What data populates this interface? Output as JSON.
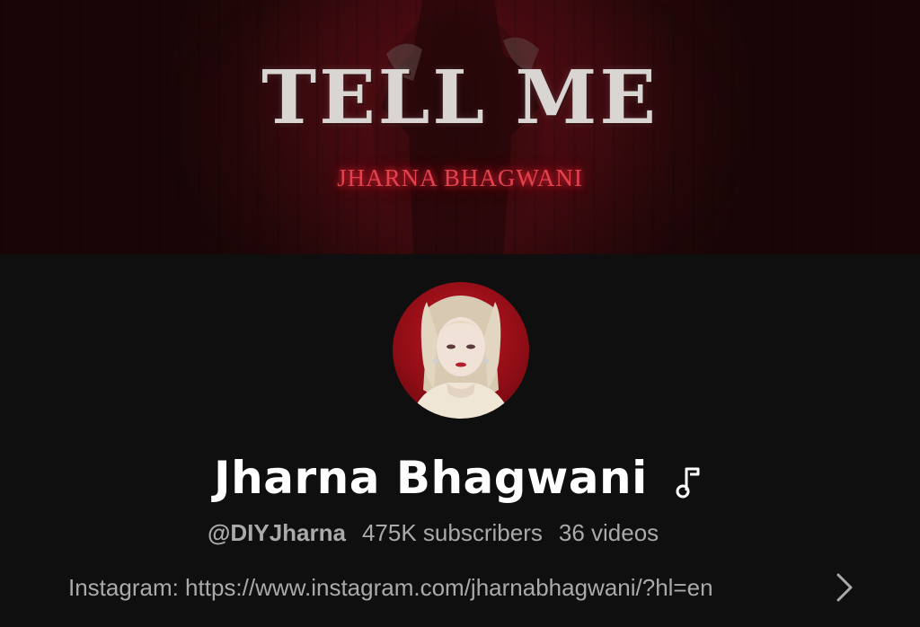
{
  "banner": {
    "title": "TELL ME",
    "subtitle": "JHARNA BHAGWANI"
  },
  "channel": {
    "name": "Jharna Bhagwani",
    "handle": "@DIYJharna",
    "subscribers": "475K subscribers",
    "videos": "36 videos",
    "link": "Instagram: https://www.instagram.com/jharnabhagwani/?hl=en"
  },
  "icons": {
    "verified": "music-note-icon",
    "more": "chevron-right-icon"
  },
  "colors": {
    "background": "#0f0f0f",
    "banner_red": "#3f0a0f",
    "neon_red": "#e2434e",
    "text_primary": "#ffffff",
    "text_secondary": "#aaaaaa"
  }
}
